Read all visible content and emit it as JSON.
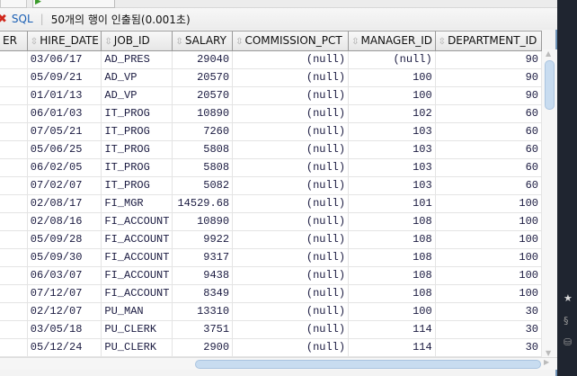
{
  "toolbar": {
    "sql_label": "SQL",
    "status": "50개의 행이 인출됨(0.001초)"
  },
  "columns": [
    "ER",
    "HIRE_DATE",
    "JOB_ID",
    "SALARY",
    "COMMISSION_PCT",
    "MANAGER_ID",
    "DEPARTMENT_ID"
  ],
  "rows": [
    [
      "",
      "03/06/17",
      "AD_PRES",
      "29040",
      "(null)",
      "(null)",
      "90"
    ],
    [
      "",
      "05/09/21",
      "AD_VP",
      "20570",
      "(null)",
      "100",
      "90"
    ],
    [
      "",
      "01/01/13",
      "AD_VP",
      "20570",
      "(null)",
      "100",
      "90"
    ],
    [
      "",
      "06/01/03",
      "IT_PROG",
      "10890",
      "(null)",
      "102",
      "60"
    ],
    [
      "",
      "07/05/21",
      "IT_PROG",
      "7260",
      "(null)",
      "103",
      "60"
    ],
    [
      "",
      "05/06/25",
      "IT_PROG",
      "5808",
      "(null)",
      "103",
      "60"
    ],
    [
      "",
      "06/02/05",
      "IT_PROG",
      "5808",
      "(null)",
      "103",
      "60"
    ],
    [
      "",
      "07/02/07",
      "IT_PROG",
      "5082",
      "(null)",
      "103",
      "60"
    ],
    [
      "",
      "02/08/17",
      "FI_MGR",
      "14529.68",
      "(null)",
      "101",
      "100"
    ],
    [
      "",
      "02/08/16",
      "FI_ACCOUNT",
      "10890",
      "(null)",
      "108",
      "100"
    ],
    [
      "",
      "05/09/28",
      "FI_ACCOUNT",
      "9922",
      "(null)",
      "108",
      "100"
    ],
    [
      "",
      "05/09/30",
      "FI_ACCOUNT",
      "9317",
      "(null)",
      "108",
      "100"
    ],
    [
      "",
      "06/03/07",
      "FI_ACCOUNT",
      "9438",
      "(null)",
      "108",
      "100"
    ],
    [
      "",
      "07/12/07",
      "FI_ACCOUNT",
      "8349",
      "(null)",
      "108",
      "100"
    ],
    [
      "",
      "02/12/07",
      "PU_MAN",
      "13310",
      "(null)",
      "100",
      "30"
    ],
    [
      "",
      "03/05/18",
      "PU_CLERK",
      "3751",
      "(null)",
      "114",
      "30"
    ],
    [
      "",
      "05/12/24",
      "PU_CLERK",
      "2900",
      "(null)",
      "114",
      "30"
    ]
  ],
  "colors": {
    "accent": "#1a5fb4",
    "scroll_thumb": "#c8dcf0"
  }
}
